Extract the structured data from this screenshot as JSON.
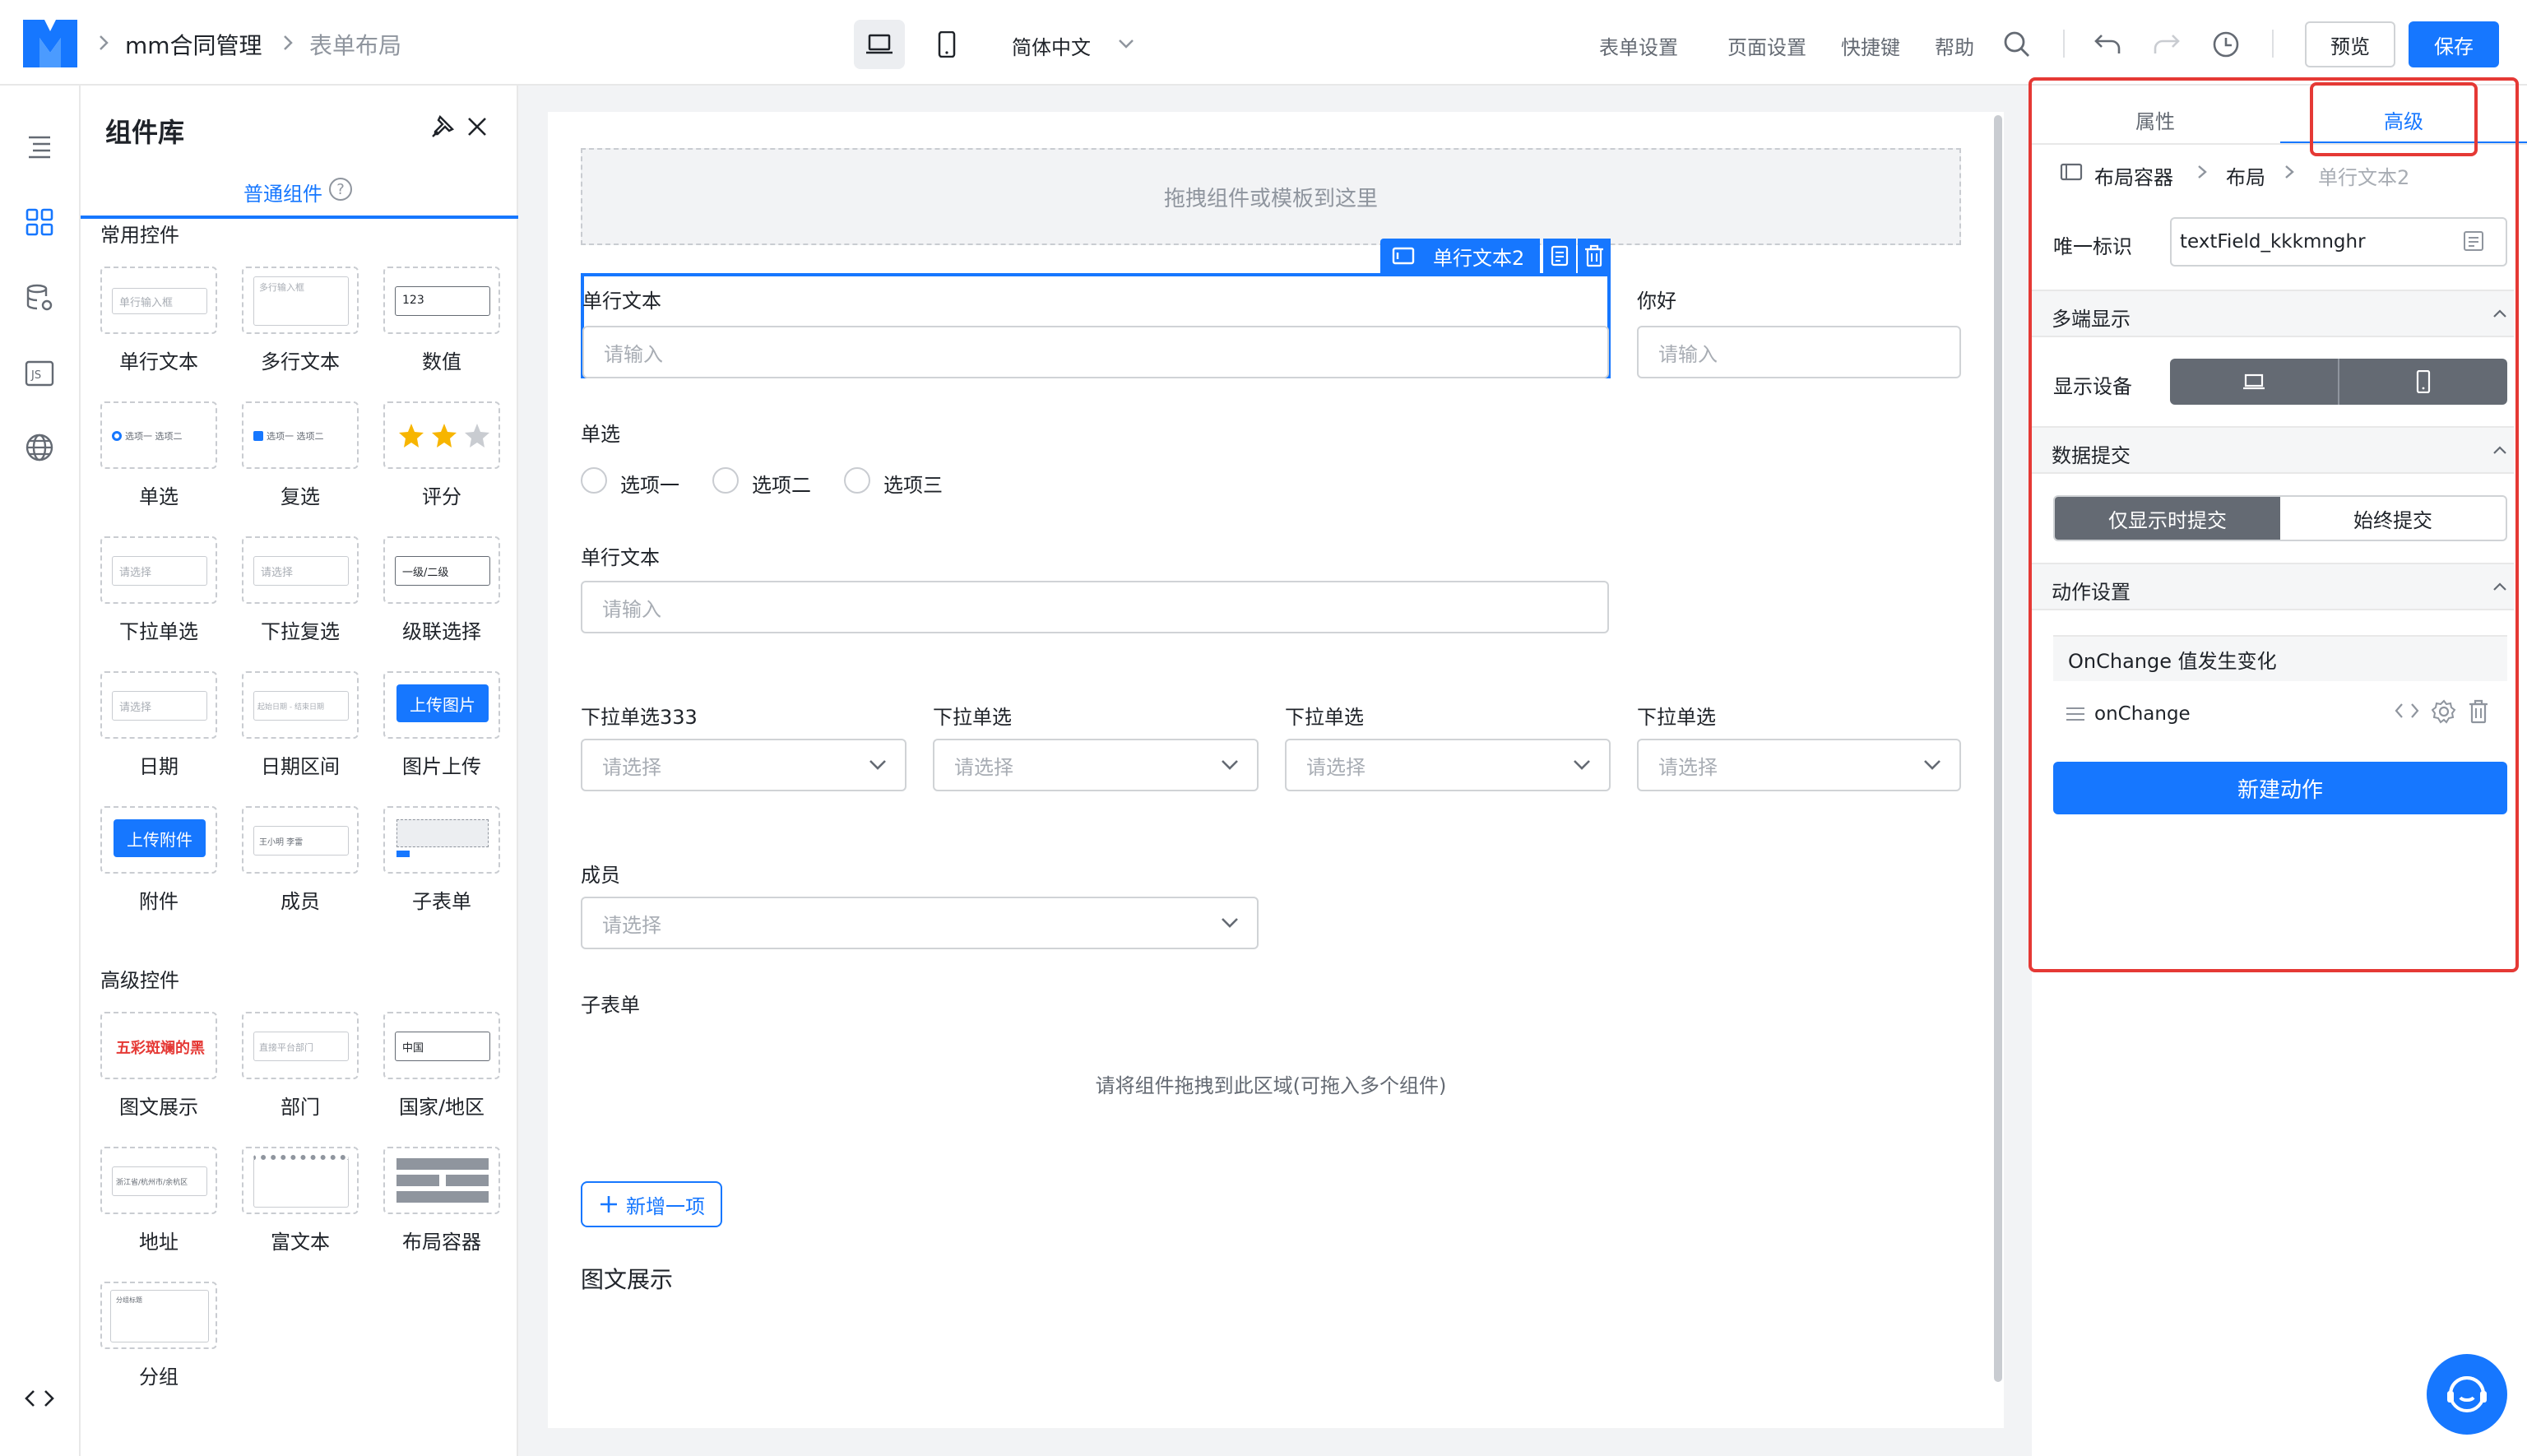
{
  "header": {
    "breadcrumb_app": "mm合同管理",
    "breadcrumb_page": "表单布局",
    "language": "简体中文",
    "links": [
      "表单设置",
      "页面设置",
      "快捷键",
      "帮助"
    ],
    "preview_label": "预览",
    "save_label": "保存"
  },
  "left_rail": {
    "icons": [
      "outline-icon",
      "components-icon",
      "datasource-icon",
      "js-icon",
      "globe-icon",
      "code-icon"
    ]
  },
  "component_panel": {
    "title": "组件库",
    "tab_label": "普通组件",
    "tab_help": "?",
    "common_title": "常用控件",
    "common_items": [
      {
        "label": "单行文本",
        "preview": "单行输入框"
      },
      {
        "label": "多行文本",
        "preview": "多行输入框"
      },
      {
        "label": "数值",
        "preview": "123"
      },
      {
        "label": "单选",
        "preview": "选项一 选项二"
      },
      {
        "label": "复选",
        "preview": "选项一 选项二"
      },
      {
        "label": "评分",
        "preview": ""
      },
      {
        "label": "下拉单选",
        "preview": "请选择"
      },
      {
        "label": "下拉复选",
        "preview": "请选择"
      },
      {
        "label": "级联选择",
        "preview": "一级/二级"
      },
      {
        "label": "日期",
        "preview": "请选择"
      },
      {
        "label": "日期区间",
        "preview": "起始日期 - 结束日期"
      },
      {
        "label": "图片上传",
        "preview": "上传图片"
      },
      {
        "label": "附件",
        "preview": "上传附件"
      },
      {
        "label": "成员",
        "preview": "王小明 李雷"
      },
      {
        "label": "子表单",
        "preview": ""
      }
    ],
    "advanced_title": "高级控件",
    "advanced_items": [
      {
        "label": "图文展示",
        "preview": "五彩斑斓的黑"
      },
      {
        "label": "部门",
        "preview": "直接平台部门"
      },
      {
        "label": "国家/地区",
        "preview": "中国"
      },
      {
        "label": "地址",
        "preview": "浙江省/杭州市/余杭区"
      },
      {
        "label": "富文本",
        "preview": ""
      },
      {
        "label": "布局容器",
        "preview": ""
      },
      {
        "label": "分组",
        "preview": "分组标题"
      }
    ]
  },
  "canvas": {
    "dropzone_text": "拖拽组件或模板到这里",
    "selected_tag": "单行文本2",
    "field1_label": "单行文本",
    "field1_placeholder": "请输入",
    "field2_label": "你好",
    "field2_placeholder": "请输入",
    "radio_label": "单选",
    "radio_options": [
      "选项一",
      "选项二",
      "选项三"
    ],
    "field3_label": "单行文本",
    "field3_placeholder": "请输入",
    "selects": [
      {
        "label": "下拉单选333",
        "placeholder": "请选择"
      },
      {
        "label": "下拉单选",
        "placeholder": "请选择"
      },
      {
        "label": "下拉单选",
        "placeholder": "请选择"
      },
      {
        "label": "下拉单选",
        "placeholder": "请选择"
      }
    ],
    "member_label": "成员",
    "member_placeholder": "请选择",
    "subform_label": "子表单",
    "subform_hint": "请将组件拖拽到此区域(可拖入多个组件)",
    "add_item_label": "新增一项",
    "richtext_label": "图文展示"
  },
  "right_panel": {
    "tabs": [
      "属性",
      "高级"
    ],
    "active_tab": "高级",
    "breadcrumb": [
      "布局容器",
      "布局",
      "单行文本2"
    ],
    "id_label": "唯一标识",
    "id_value": "textField_kkkmnghr",
    "multi_title": "多端显示",
    "device_label": "显示设备",
    "submit_title": "数据提交",
    "submit_options": [
      "仅显示时提交",
      "始终提交"
    ],
    "submit_selected": "仅显示时提交",
    "action_title": "动作设置",
    "action_event": "OnChange 值发生变化",
    "action_name": "onChange",
    "new_action_label": "新建动作"
  },
  "colors": {
    "primary": "#1677ff",
    "highlight_box": "#e53935",
    "segment_active": "#646a73"
  }
}
